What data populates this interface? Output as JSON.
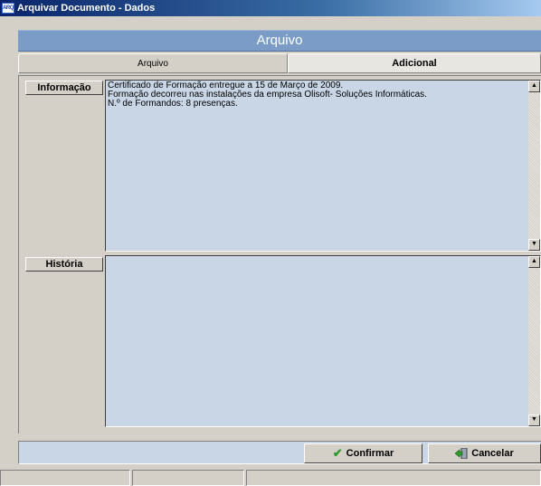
{
  "window": {
    "title": "Arquivar Documento - Dados",
    "icon_text": "ARQ"
  },
  "header": {
    "title": "Arquivo"
  },
  "tabs": [
    {
      "label": "Arquivo",
      "active": false
    },
    {
      "label": "Adicional",
      "active": true
    }
  ],
  "informacao": {
    "label": "Informação",
    "lines": [
      "Certificado de Formação entregue a 15 de Março de 2009.",
      "Formação decorreu nas instalações da empresa Olisoft- Soluções Informáticas.",
      "N.º de Formandos: 8 presenças."
    ]
  },
  "historia": {
    "label": "História",
    "text": ""
  },
  "buttons": {
    "confirm": "Confirmar",
    "cancel": "Cancelar"
  },
  "colors": {
    "title_gradient_start": "#0a246a",
    "header_band": "#7b9cc6",
    "memo_bg": "#c9d6e6",
    "confirm_check": "#2d9b2d"
  },
  "icons": {
    "app": "app-arq-icon",
    "confirm": "check-icon",
    "cancel": "exit-door-icon",
    "scroll_up": "scroll-up-arrow-icon",
    "scroll_down": "scroll-down-arrow-icon"
  }
}
